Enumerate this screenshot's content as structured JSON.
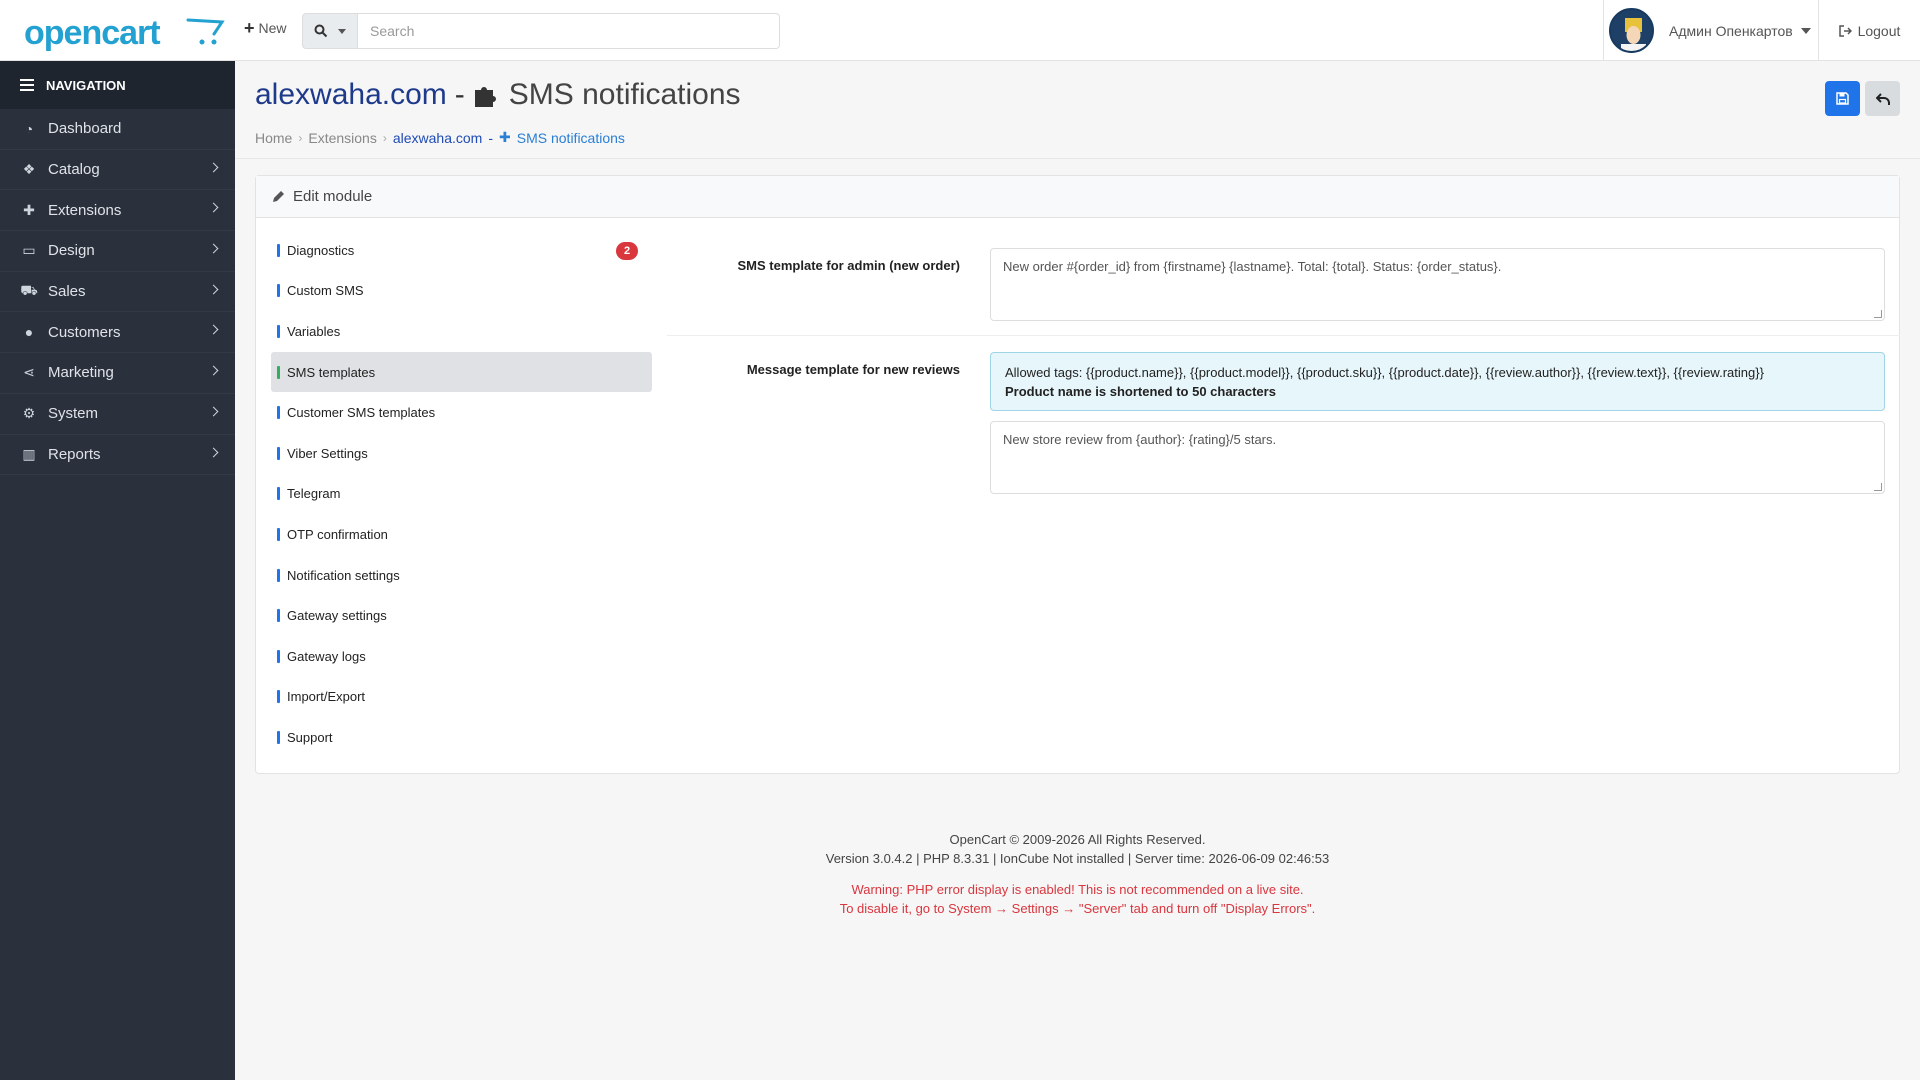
{
  "header": {
    "logo": "opencart",
    "new_label": "New",
    "search_placeholder": "Search",
    "user_name": "Админ Опенкартов",
    "logout_label": "Logout"
  },
  "sidebar": {
    "title": "NAVIGATION",
    "items": [
      {
        "label": "Dashboard",
        "icon": "dashboard-icon"
      },
      {
        "label": "Catalog",
        "icon": "tags-icon"
      },
      {
        "label": "Extensions",
        "icon": "puzzle-icon"
      },
      {
        "label": "Design",
        "icon": "monitor-icon"
      },
      {
        "label": "Sales",
        "icon": "cart-icon"
      },
      {
        "label": "Customers",
        "icon": "user-icon"
      },
      {
        "label": "Marketing",
        "icon": "share-icon"
      },
      {
        "label": "System",
        "icon": "gear-icon"
      },
      {
        "label": "Reports",
        "icon": "bar-chart-icon"
      }
    ]
  },
  "page": {
    "title_site": "alexwaha.com",
    "title_sep": "-",
    "title_module": "SMS notifications",
    "breadcrumb": [
      "Home",
      "Extensions",
      "alexwaha.com",
      "SMS notifications"
    ]
  },
  "card": {
    "heading": "Edit module",
    "tabs": [
      {
        "label": "Diagnostics",
        "badge": "2"
      },
      {
        "label": "Custom SMS"
      },
      {
        "label": "Variables"
      },
      {
        "label": "SMS templates"
      },
      {
        "label": "Customer SMS templates"
      },
      {
        "label": "Viber Settings"
      },
      {
        "label": "Telegram"
      },
      {
        "label": "OTP confirmation"
      },
      {
        "label": "Notification settings"
      },
      {
        "label": "Gateway settings"
      },
      {
        "label": "Gateway logs"
      },
      {
        "label": "Import/Export"
      },
      {
        "label": "Support"
      }
    ],
    "active_tab": "SMS templates",
    "fields": {
      "admin_label": "SMS template for admin (new order)",
      "admin_value": "New order #{order_id} from {firstname} {lastname}. Total: {total}. Status: {order_status}.",
      "review_label": "Message template for new reviews",
      "review_info": "Allowed tags: {{product.name}}, {{product.model}}, {{product.sku}}, {{product.date}}, {{review.author}}, {{review.text}}, {{review.rating}}",
      "review_info_bold": "Product name is shortened to 50 characters",
      "review_value": "New store review from {author}: {rating}/5 stars."
    }
  },
  "footer": {
    "line1": "OpenCart © 2009-2026 All Rights Reserved.",
    "line2": "Version 3.0.4.2 | PHP 8.3.31 | IonCube Not installed | Server time: 2026-06-09 02:46:53",
    "warn1": "Warning: PHP error display is enabled! This is not recommended on a live site.",
    "warn2": "To disable it, go to System → Settings → \"Server\" tab and turn off \"Display Errors\"."
  },
  "colors": {
    "accent": "#1e74e8",
    "sidebar_bg": "#2a313d",
    "badge": "#d9363e",
    "active_tab_mark": "#2fb05f"
  }
}
